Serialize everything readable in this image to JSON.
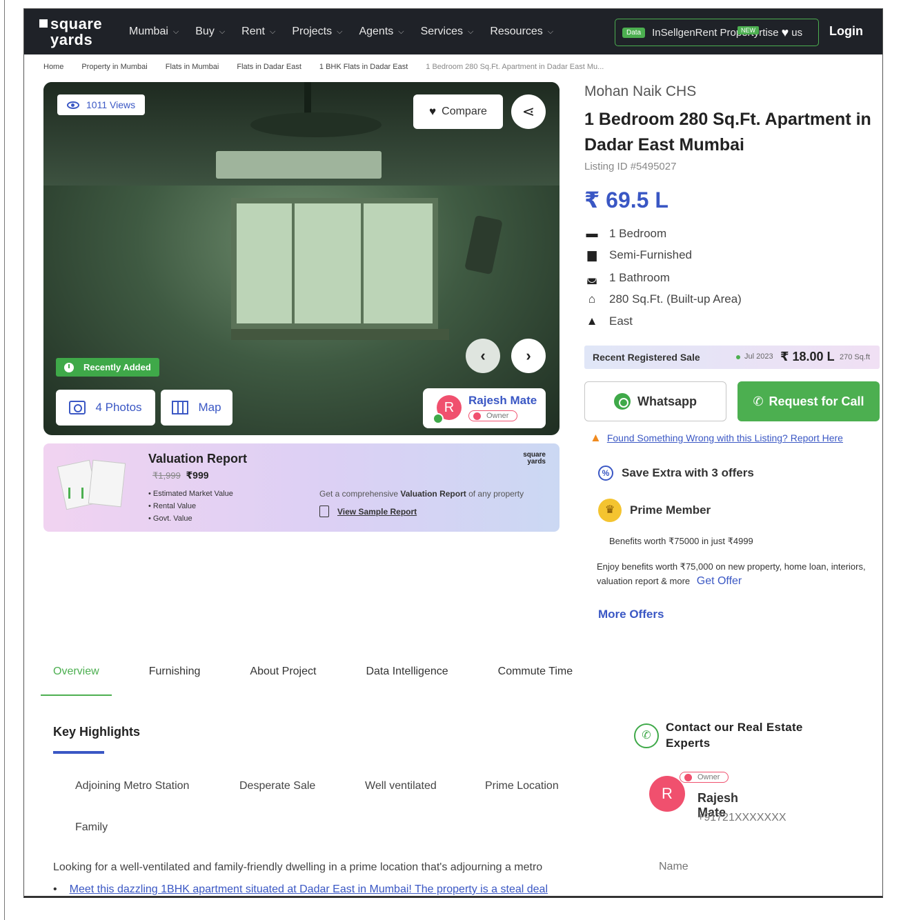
{
  "header": {
    "logo_line1": "square",
    "logo_line2": "yards",
    "nav": [
      {
        "label": "Mumbai"
      },
      {
        "label": "Buy"
      },
      {
        "label": "Rent"
      },
      {
        "label": "Projects"
      },
      {
        "label": "Agents"
      },
      {
        "label": "Services"
      },
      {
        "label": "Resources"
      }
    ],
    "data_tag": "Data",
    "box_text": "InSellgenRent Propertyrtise",
    "box_tail": "us",
    "new_tag": "NEW",
    "login": "Login"
  },
  "breadcrumbs": [
    "Home",
    "Property in Mumbai",
    "Flats in Mumbai",
    "Flats in Dadar East",
    "1 BHK Flats in Dadar East",
    "1 Bedroom 280 Sq.Ft. Apartment in Dadar East Mu..."
  ],
  "gallery": {
    "views": "1011 Views",
    "compare": "Compare",
    "recently_added": "Recently Added",
    "photos": "4 Photos",
    "map": "Map",
    "owner_name": "Rajesh Mate",
    "owner_initial": "R",
    "owner_role": "Owner"
  },
  "valuation": {
    "title": "Valuation Report",
    "old_price": "₹1,999",
    "price": "₹999",
    "items": [
      "Estimated Market Value",
      "Rental Value",
      "Govt. Value"
    ],
    "brand_line1": "square",
    "brand_line2": "yards",
    "desc_prefix": "Get a comprehensive",
    "desc_bold": "Valuation Report",
    "desc_suffix": "of any property",
    "sample": "View Sample Report"
  },
  "property": {
    "project": "Mohan Naik CHS",
    "title": "1 Bedroom 280 Sq.Ft. Apartment in Dadar East Mumbai",
    "listing_id": "Listing ID #5495027",
    "price": "₹ 69.5 L",
    "features": [
      {
        "icon": "bed-icon",
        "text": "1 Bedroom"
      },
      {
        "icon": "sofa-icon",
        "text": "Semi-Furnished"
      },
      {
        "icon": "bathtub-icon",
        "text": "1 Bathroom"
      },
      {
        "icon": "home-icon",
        "text": "280 Sq.Ft. (Built-up Area)"
      },
      {
        "icon": "direction-icon",
        "text": "East"
      }
    ]
  },
  "recent_sale": {
    "label": "Recent Registered Sale",
    "date": "Jul 2023",
    "amount": "₹ 18.00 L",
    "area": "270 Sq.ft"
  },
  "actions": {
    "whatsapp": "Whatsapp",
    "request_call": "Request for Call",
    "report": "Found Something Wrong with this Listing? Report Here"
  },
  "offers": {
    "save_extra": "Save Extra with 3 offers",
    "prime": "Prime Member",
    "benefits": "Benefits worth ₹75000 in just ₹4999",
    "enjoy": "Enjoy benefits worth ₹75,000 on new property, home loan, interiors, valuation report & more",
    "get_offer": "Get Offer",
    "more_offers": "More Offers"
  },
  "tabs": [
    "Overview",
    "Furnishing",
    "About Project",
    "Data Intelligence",
    "Commute Time"
  ],
  "highlights": {
    "title": "Key Highlights",
    "items": [
      "Adjoining Metro Station",
      "Desperate Sale",
      "Well ventilated",
      "Prime Location",
      "Family"
    ]
  },
  "description": {
    "intro": "Looking for a well-ventilated and family-friendly dwelling in a prime location that's adjourning a metro",
    "bullet": "Meet this dazzling 1BHK apartment situated at Dadar East in Mumbai! The property is a steal deal"
  },
  "contact": {
    "title": "Contact our Real Estate Experts",
    "role": "Owner",
    "initial": "R",
    "name": "Rajesh Mate",
    "phone": "+91721XXXXXXX",
    "name_placeholder": "Name"
  },
  "colors": {
    "header_bg": "#1f2228",
    "accent_blue": "#3a57c4",
    "accent_green": "#4caf50",
    "owner_pink": "#f0506e"
  }
}
